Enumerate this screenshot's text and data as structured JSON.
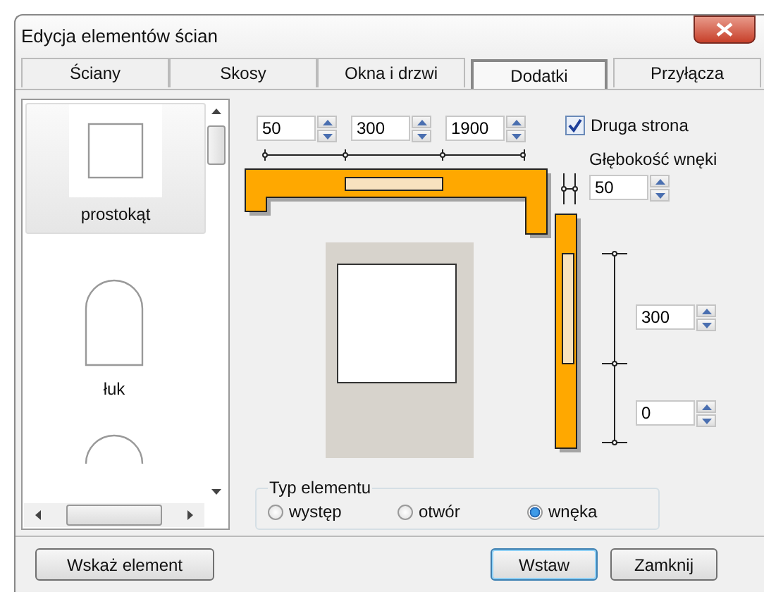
{
  "window": {
    "title": "Edycja elementów ścian"
  },
  "tabs": [
    {
      "label": "Ściany",
      "selected": false
    },
    {
      "label": "Skosy",
      "selected": false
    },
    {
      "label": "Okna i drzwi",
      "selected": false
    },
    {
      "label": "Dodatki",
      "selected": true
    },
    {
      "label": "Przyłącza",
      "selected": false
    }
  ],
  "element_list": {
    "items": [
      {
        "label": "prostokąt",
        "kind": "rectangle",
        "selected": true
      },
      {
        "label": "łuk",
        "kind": "arch",
        "selected": false
      },
      {
        "kind": "circle",
        "selected": false
      }
    ]
  },
  "widths": [
    {
      "value": "50"
    },
    {
      "value": "300"
    },
    {
      "value": "1900"
    }
  ],
  "second_side": {
    "label": "Druga strona",
    "checked": true
  },
  "depth": {
    "label": "Głębokość wnęki",
    "value": "50"
  },
  "heights": [
    {
      "value": "300"
    },
    {
      "value": "0"
    }
  ],
  "element_type": {
    "title": "Typ elementu",
    "options": [
      {
        "label": "występ",
        "selected": false
      },
      {
        "label": "otwór",
        "selected": false
      },
      {
        "label": "wnęka",
        "selected": true
      }
    ]
  },
  "buttons": [
    {
      "label": "Wskaż element",
      "default": false
    },
    {
      "label": "Wstaw",
      "default": true
    },
    {
      "label": "Zamknij",
      "default": false
    }
  ]
}
